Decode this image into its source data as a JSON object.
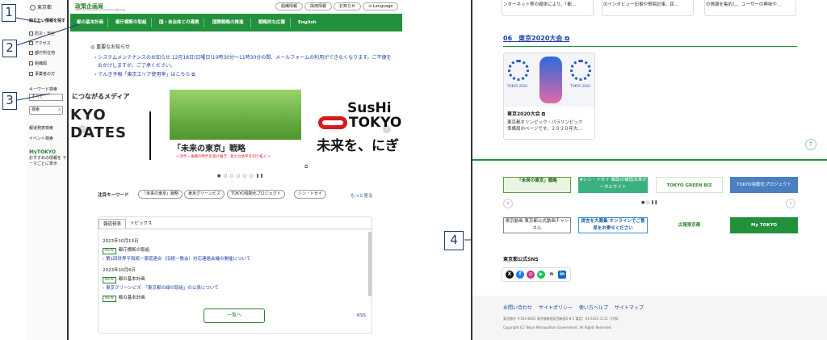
{
  "left": {
    "sidebar": {
      "logo": "東京都",
      "items": [
        "知りたい情報を探す",
        "防災・安全",
        "アクセス",
        "都庁所在地",
        "組織図",
        "事業者の方"
      ],
      "keyword_label": "キーワード検索",
      "select_value": "すべて",
      "search_placeholder": "検索",
      "links": [
        "報道発表検索",
        "イベント検索"
      ],
      "mytokyo_title": "MyTOKYO",
      "mytokyo_desc": "おすすめの情報を テーマごとに表示"
    },
    "header": {
      "brand": "政策企画局",
      "brand_sub": "Office of the Governor for Policy Planning",
      "utility": [
        "組織情報",
        "採用情報",
        "お知らせ"
      ],
      "language": "Language"
    },
    "nav": [
      "都の基本計画",
      "都庁横断の取組",
      "国・自治体との連携",
      "国際戦略の推進",
      "戦略的な広報",
      "English"
    ],
    "notices": {
      "title": "重要なお知らせ",
      "items": [
        "システムメンテナンスのお知らせ 12月18日(日曜日)10時30分～11時30分の間、メールフォームの利用ができなくなります。ご不便を",
        "おかけしますが、ご了承ください。",
        "でんき予報「東京エリア使用率」はこちら"
      ]
    },
    "carousel": {
      "slide1_caption": "につながるメディア",
      "slide1_l1": "KYO",
      "slide1_l2": "DATES",
      "slide2_title": "「未来の東京」戦略",
      "slide2_sub": "～次代・後藤の時代を受け継ぎ、新たな地平を切り拓く～",
      "slide3_l1": "SusHi",
      "slide3_l2": "TOKYO",
      "slide3_l3": "未来を、にぎ"
    },
    "keywords": {
      "label": "注目キーワード",
      "pills": [
        "「未来の東京」戦略",
        "東京グリーンビズ",
        "TOKYO強靭化プロジェクト",
        "シン・トセイ"
      ],
      "more": "もっと見る"
    },
    "press": {
      "tabs": [
        "報道発表",
        "トピックス"
      ],
      "date1": "2023年10月13日",
      "badge": "NEW",
      "cat1": "都庁横断の取組",
      "title1": "第1回世界平和統一家庭連合（旧統一教会）対応連絡会議の開催について",
      "date2": "2023年10月6日",
      "cat2": "都の基本計画",
      "title2": "東京グリーンビズ　「東京都の緑の取組」の公表について",
      "cat3": "都の基本計画",
      "more_btn": "一覧へ",
      "rss": "RSS"
    }
  },
  "callouts": [
    "1",
    "2",
    "3",
    "4"
  ],
  "right": {
    "top_cols": [
      "ンターネット等の媒体により、「都…",
      "のインタビュー記事や寄稿記事、民…",
      "の情報を集約し、ユーザーの興味や…"
    ],
    "section06": "06　東京2020大会",
    "card": {
      "title": "東京2020大会",
      "desc1": "東京都オリンピック・パラリンピック",
      "desc2": "準備局のページです。２０２０年大…",
      "img_text1": "TOKYO 2020",
      "img_text2": "TOKYO 2020"
    },
    "banners_row1": [
      "「未来の東京」戦略",
      "#シン・トセイ 都政の構造改革ポータルサイト",
      "TOKYO GREEN BIZ",
      "TOKYO強靭化プロジェクト"
    ],
    "banners_row2": [
      "東京動画 東京都公式動画チャンネル",
      "提言を大募集 オンラインでご意見をお寄せください",
      "広報東京都",
      "My TOKYO"
    ],
    "sns_title": "東京都公式SNS",
    "sns_icons": [
      "X",
      "f",
      "◎",
      "▶",
      "n",
      "in"
    ],
    "footer_links": [
      "お問い合わせ",
      "サイトポリシー",
      "使い方ヘルプ",
      "サイトマップ"
    ],
    "address": "東京都庁 〒163-8001 東京都新宿区西新宿2-8-1 電話：03-5321-1111（代表）",
    "copyright": "Copyright (C) Tokyo Metropolitan Government. All Rights Reserved."
  }
}
